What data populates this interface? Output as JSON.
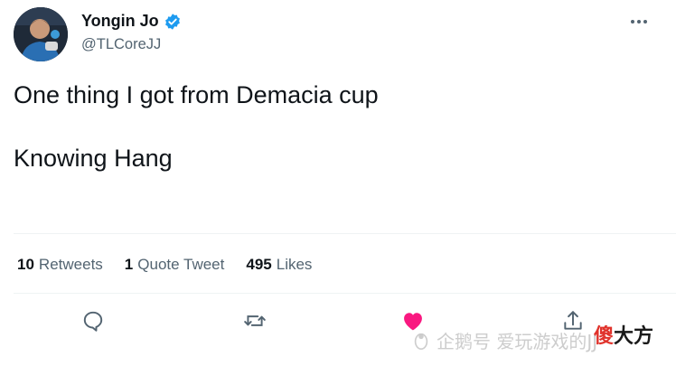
{
  "user": {
    "display_name": "Yongin Jo",
    "handle": "@TLCoreJJ",
    "verified": true
  },
  "tweet": {
    "lines": [
      "One thing I got from Demacia cup",
      "Knowing Hang"
    ]
  },
  "stats": {
    "retweets_count": "10",
    "retweets_label": "Retweets",
    "quotes_count": "1",
    "quotes_label": "Quote Tweet",
    "likes_count": "495",
    "likes_label": "Likes"
  },
  "actions": {
    "icons": [
      "reply-icon",
      "retweet-icon",
      "like-icon",
      "share-icon"
    ],
    "liked": true
  },
  "watermark": {
    "source": "企鹅号 爱玩游戏的JJ",
    "brand_red": "傻",
    "brand_rest": "大方"
  },
  "colors": {
    "text": "#0f1419",
    "secondary": "#536471",
    "divider": "#eff3f4",
    "verified_blue": "#1d9bf0",
    "like_pink": "#f91880"
  }
}
